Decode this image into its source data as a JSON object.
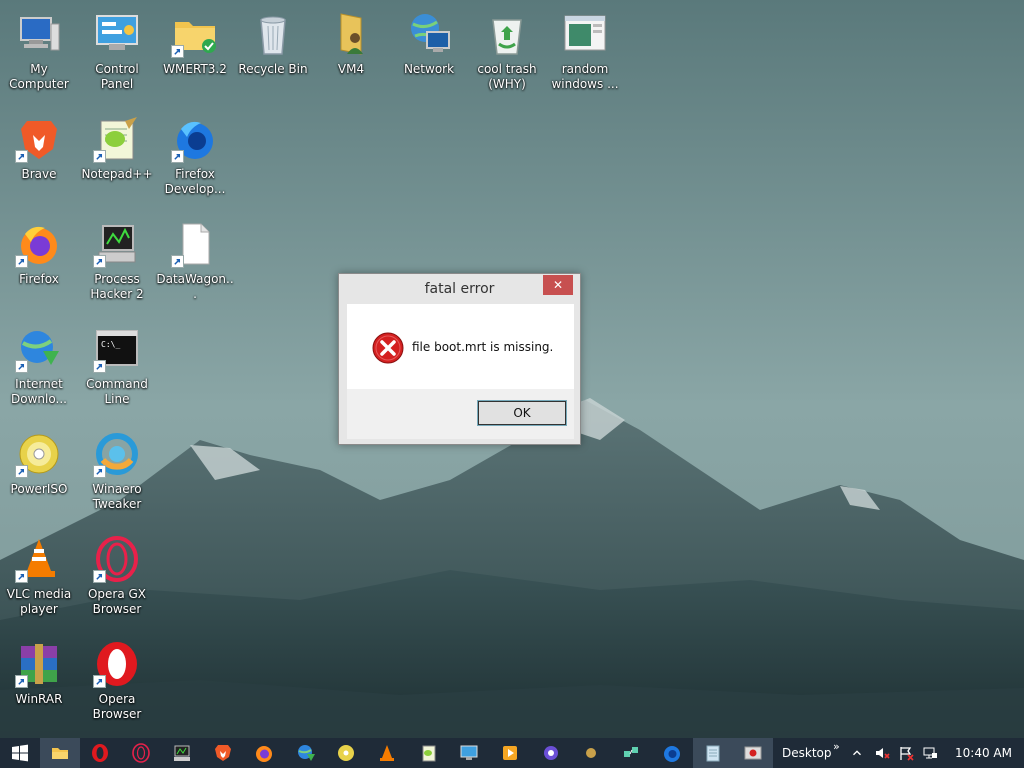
{
  "desktop": {
    "icons": [
      {
        "label": "My Computer",
        "icon": "computer-icon"
      },
      {
        "label": "Control Panel",
        "icon": "control-panel-icon"
      },
      {
        "label": "WMERT3.2",
        "icon": "folder-icon"
      },
      {
        "label": "Recycle Bin",
        "icon": "recycle-bin-icon"
      },
      {
        "label": "VM4",
        "icon": "user-folder-icon"
      },
      {
        "label": "Network",
        "icon": "network-icon"
      },
      {
        "label": "cool trash (WHY)",
        "icon": "recycle-bin-full-icon"
      },
      {
        "label": "random windows ...",
        "icon": "window-icon"
      },
      {
        "label": "Brave",
        "icon": "brave-icon"
      },
      {
        "label": "Notepad++",
        "icon": "notepad-plus-plus-icon"
      },
      {
        "label": "Firefox Develop...",
        "icon": "firefox-developer-icon"
      },
      {
        "label": "Firefox",
        "icon": "firefox-icon"
      },
      {
        "label": "Process Hacker 2",
        "icon": "process-hacker-icon"
      },
      {
        "label": "DataWagon...",
        "icon": "file-icon"
      },
      {
        "label": "Internet Downlo...",
        "icon": "internet-download-manager-icon"
      },
      {
        "label": "Command Line",
        "icon": "command-line-icon"
      },
      {
        "label": "PowerISO",
        "icon": "poweriso-icon"
      },
      {
        "label": "Winaero Tweaker",
        "icon": "winaero-tweaker-icon"
      },
      {
        "label": "VLC media player",
        "icon": "vlc-icon"
      },
      {
        "label": "Opera GX Browser",
        "icon": "opera-gx-icon"
      },
      {
        "label": "WinRAR",
        "icon": "winrar-icon"
      },
      {
        "label": "Opera Browser",
        "icon": "opera-icon"
      }
    ]
  },
  "dialog": {
    "title": "fatal error",
    "close_label": "✕",
    "message": "file boot.mrt is missing.",
    "ok_label": "OK",
    "icon": "error-icon"
  },
  "taskbar": {
    "toolbar_label": "Desktop",
    "toolbar_chevron": "»",
    "clock": "10:40 AM",
    "pinned": [
      "windows-start-icon",
      "file-explorer-icon",
      "opera-icon",
      "opera-gx-icon",
      "process-hacker-icon",
      "brave-icon",
      "firefox-icon",
      "internet-download-manager-icon",
      "poweriso-icon",
      "vlc-icon",
      "notepad-plus-plus-icon",
      "control-panel-icon",
      "media-player-icon",
      "winaero-tweaker-icon",
      "shell-icon",
      "network-tool-icon",
      "firefox-developer-icon",
      "notepad-icon",
      "error-window-icon"
    ]
  },
  "colors": {
    "taskbar": "#1f2b38",
    "close_button": "#c75050",
    "error_red": "#d42020"
  }
}
